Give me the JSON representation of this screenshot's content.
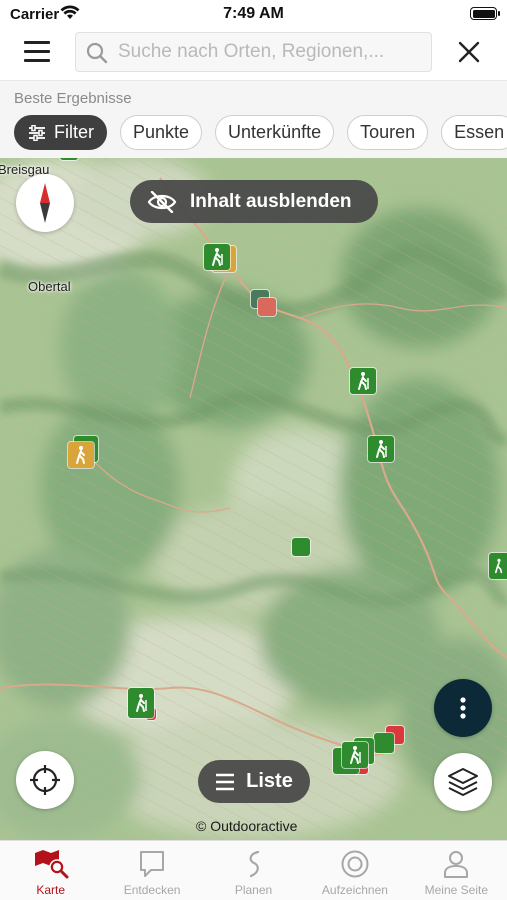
{
  "status_bar": {
    "carrier": "Carrier",
    "time": "7:49 AM"
  },
  "header": {
    "search_placeholder": "Suche nach Orten, Regionen,..."
  },
  "filters": {
    "heading": "Beste Ergebnisse",
    "filter_label": "Filter",
    "categories": [
      "Punkte",
      "Unterkünfte",
      "Touren",
      "Essen"
    ]
  },
  "map": {
    "hide_content_label": "Inhalt ausblenden",
    "list_label": "Liste",
    "attribution": "© Outdooractive",
    "place_labels": [
      "Breisgau",
      "Obertal"
    ],
    "colors": {
      "hiking": "#2e8b2e",
      "lodging": "#d9a53a",
      "poi_red": "#d9393d"
    }
  },
  "tabbar": {
    "active_color": "#b4121b",
    "tabs": [
      {
        "label": "Karte",
        "icon": "map-search-icon",
        "active": true
      },
      {
        "label": "Entdecken",
        "icon": "chat-bubble-icon",
        "active": false
      },
      {
        "label": "Planen",
        "icon": "route-icon",
        "active": false
      },
      {
        "label": "Aufzeichnen",
        "icon": "record-icon",
        "active": false
      },
      {
        "label": "Meine Seite",
        "icon": "user-icon",
        "active": false
      }
    ]
  }
}
